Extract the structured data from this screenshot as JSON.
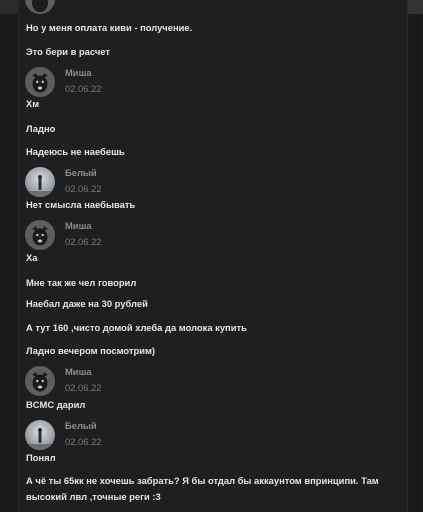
{
  "messages": [
    {
      "text": "Но у меня оплата киви - получение."
    },
    {
      "text": "Это бери в расчет"
    },
    {
      "text": "Хм"
    },
    {
      "text": "Ладно"
    },
    {
      "text": "Надеюсь не наебешь"
    },
    {
      "text": "Нет смысла наебывать"
    },
    {
      "text": "Ха"
    },
    {
      "text": "Мне так же чел говорил"
    },
    {
      "text": "Наебал даже на 30 рублей"
    },
    {
      "text": "А тут 160 ,чисто домой хлеба да молока купить"
    },
    {
      "text": "Ладно вечером посмотрим)"
    },
    {
      "text": "BCMC дарил"
    },
    {
      "text": "Понял"
    },
    {
      "text": "А чё ты 65кк не хочешь забрать? Я бы отдал бы аккаунтом впринципи. Там высокий лвл ,точные реги :3"
    }
  ],
  "authors": [
    {
      "name": "Миша",
      "date": "02.06.22",
      "avatar": "dog-avatar"
    },
    {
      "name": "Белый",
      "date": "02.06.22",
      "avatar": "photo-avatar"
    },
    {
      "name": "Миша",
      "date": "02.06.22",
      "avatar": "dog-avatar"
    },
    {
      "name": "Миша",
      "date": "02.06.22",
      "avatar": "dog-avatar"
    },
    {
      "name": "Белый",
      "date": "02.06.22",
      "avatar": "photo-avatar"
    }
  ]
}
